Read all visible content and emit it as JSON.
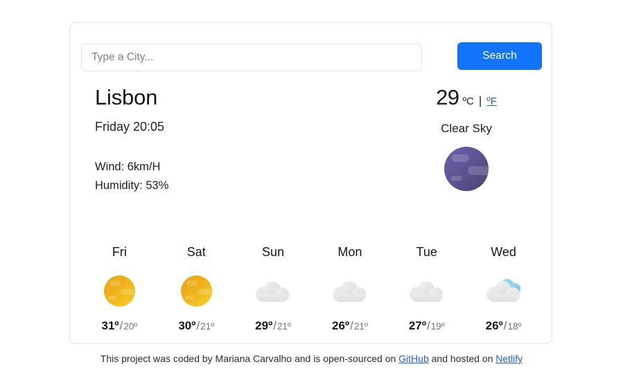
{
  "search": {
    "placeholder": "Type a City...",
    "value": "",
    "button_label": "Search"
  },
  "current": {
    "city": "Lisbon",
    "datetime": "Friday 20:05",
    "wind": "Wind: 6km/H",
    "humidity": "Humidity: 53%",
    "temperature": "29",
    "unit_celsius": "ºC",
    "unit_separator": "|",
    "unit_fahrenheit": "ºF",
    "description": "Clear Sky",
    "icon": "moon-icon"
  },
  "forecast": [
    {
      "day": "Fri",
      "icon": "sun-icon",
      "max": "31º",
      "slash": "/",
      "min": "20º"
    },
    {
      "day": "Sat",
      "icon": "sun-icon",
      "max": "30º",
      "slash": "/",
      "min": "21º"
    },
    {
      "day": "Sun",
      "icon": "cloud-icon",
      "max": "29º",
      "slash": "/",
      "min": "21º"
    },
    {
      "day": "Mon",
      "icon": "cloud-icon",
      "max": "26º",
      "slash": "/",
      "min": "21º"
    },
    {
      "day": "Tue",
      "icon": "cloud-icon",
      "max": "27º",
      "slash": "/",
      "min": "19º"
    },
    {
      "day": "Wed",
      "icon": "partly-cloudy-icon",
      "max": "26º",
      "slash": "/",
      "min": "18º"
    }
  ],
  "footer": {
    "text_before": "This project was coded by Mariana Carvalho and is open-sourced on",
    "link_github": "GitHub",
    "text_middle": "and hosted on",
    "link_netlify": "Netlify"
  },
  "colors": {
    "accent_blue": "#1273fd",
    "link_blue": "#1f5fd0",
    "sun_gold": "#edb01b",
    "moon_purple": "#5d5694",
    "cloud_gray": "#e3e3e5",
    "cloud_blue": "#83cdf2",
    "card_border": "#e2e3e5"
  }
}
